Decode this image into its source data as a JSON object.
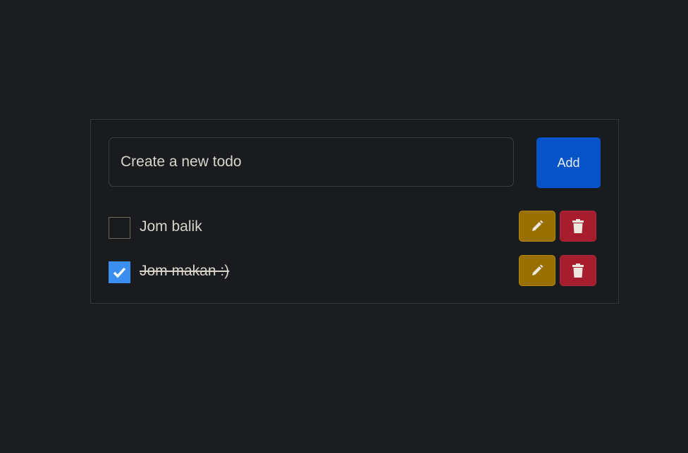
{
  "form": {
    "placeholder": "Create a new todo",
    "value": "",
    "add_label": "Add"
  },
  "todos": [
    {
      "text": "Jom balik",
      "completed": false
    },
    {
      "text": "Jom makan :)",
      "completed": true
    }
  ],
  "colors": {
    "add": "#0553c6",
    "edit": "#997000",
    "delete": "#a61e2d",
    "checked": "#3b8ef0"
  }
}
